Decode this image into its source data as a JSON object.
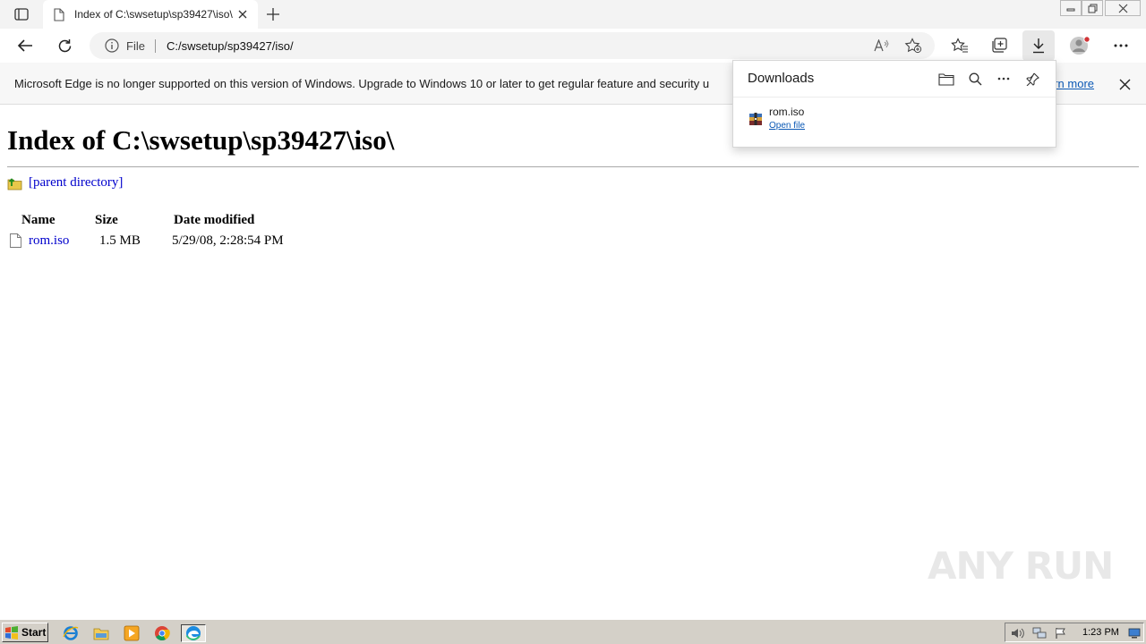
{
  "tab": {
    "title": "Index of C:\\swsetup\\sp39427\\iso\\"
  },
  "address_bar": {
    "scheme_label": "File",
    "url": "C:/swsetup/sp39427/iso/"
  },
  "info_bar": {
    "message": "Microsoft Edge is no longer supported on this version of Windows. Upgrade to Windows 10 or later to get regular feature and security u",
    "learn_more": "arn more"
  },
  "page": {
    "heading": "Index of C:\\swsetup\\sp39427\\iso\\",
    "parent_link": "[parent directory]",
    "columns": {
      "name": "Name",
      "size": "Size",
      "date": "Date modified"
    },
    "files": [
      {
        "name": "rom.iso",
        "size": "1.5 MB",
        "date": "5/29/08, 2:28:54 PM"
      }
    ]
  },
  "downloads_panel": {
    "title": "Downloads",
    "items": [
      {
        "name": "rom.iso",
        "action": "Open file"
      }
    ]
  },
  "watermark": {
    "text": "ANY RUN"
  },
  "taskbar": {
    "start_label": "Start",
    "clock": "1:23 PM"
  },
  "colors": {
    "link": "#0000cc",
    "accent": "#0a58b5",
    "taskbar": "#d4d0c8"
  }
}
